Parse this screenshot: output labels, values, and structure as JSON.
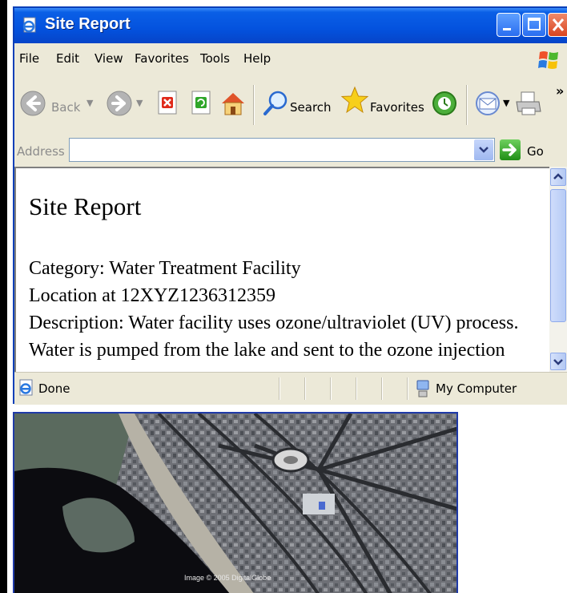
{
  "window": {
    "title": "Site Report"
  },
  "menu": {
    "items": [
      "File",
      "Edit",
      "View",
      "Favorites",
      "Tools",
      "Help"
    ]
  },
  "toolbar": {
    "back_label": "Back",
    "search_label": "Search",
    "favorites_label": "Favorites",
    "more_label": "»"
  },
  "address": {
    "label": "Address",
    "value": "",
    "go_label": "Go"
  },
  "page": {
    "heading": "Site Report",
    "lines": [
      "Category: Water Treatment Facility",
      "Location at 12XYZ1236312359",
      "Description: Water facility uses ozone/ultraviolet (UV) process.",
      "Water is pumped from the lake and sent to the ozone injection"
    ]
  },
  "status": {
    "text": "Done",
    "zone": "My Computer"
  },
  "image": {
    "credit": "Image © 2005 DigitalGlobe"
  },
  "colors": {
    "titlebar": "#0452de",
    "chrome": "#ece9d8",
    "close": "#d84420"
  }
}
